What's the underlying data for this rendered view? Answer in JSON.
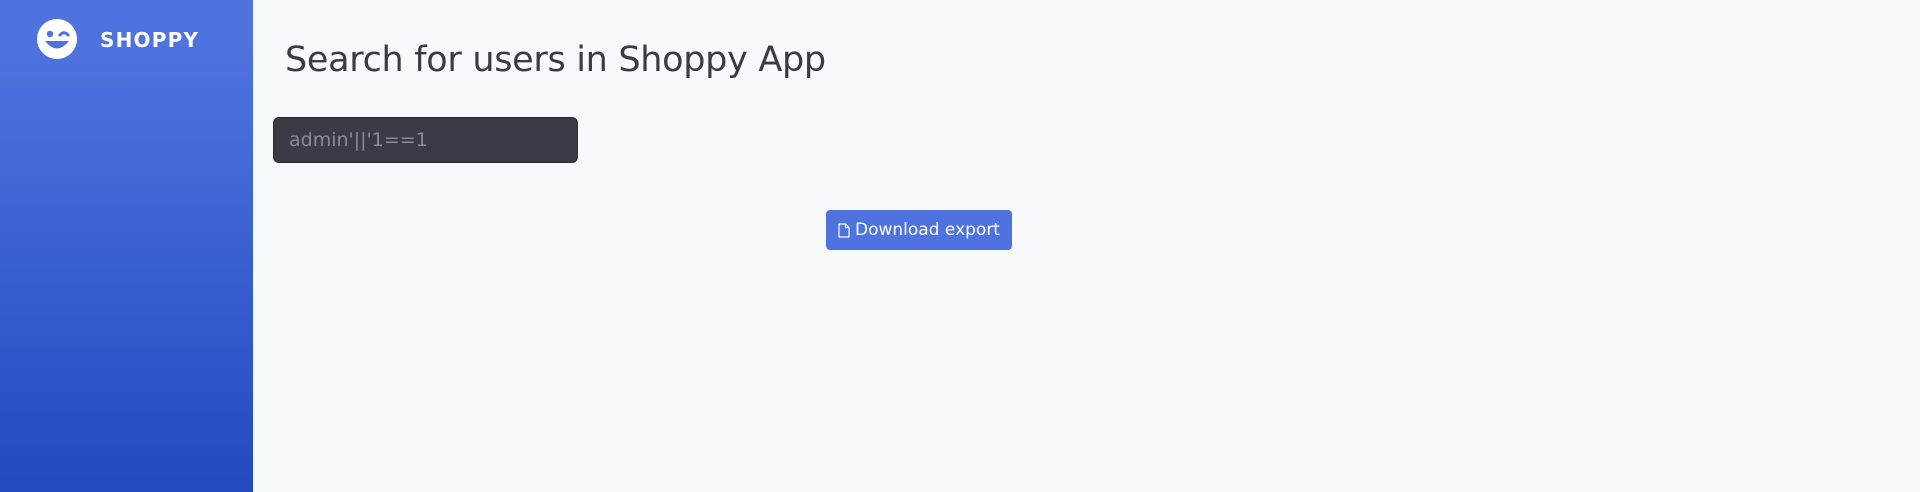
{
  "sidebar": {
    "brand": {
      "name": "SHOPPY",
      "icon": "grin-wink-icon"
    }
  },
  "main": {
    "title": "Search for users in Shoppy App",
    "search": {
      "placeholder": "admin'||'1==1",
      "value": ""
    },
    "download_button": {
      "label": "Download export",
      "icon": "file-icon"
    }
  },
  "colors": {
    "sidebar_gradient_top": "#4e73df",
    "sidebar_gradient_bottom": "#224abe",
    "page_background": "#f8f9fc",
    "title_text": "#3a3b45",
    "search_background": "#3a3b45",
    "button_primary": "#4e73df"
  }
}
